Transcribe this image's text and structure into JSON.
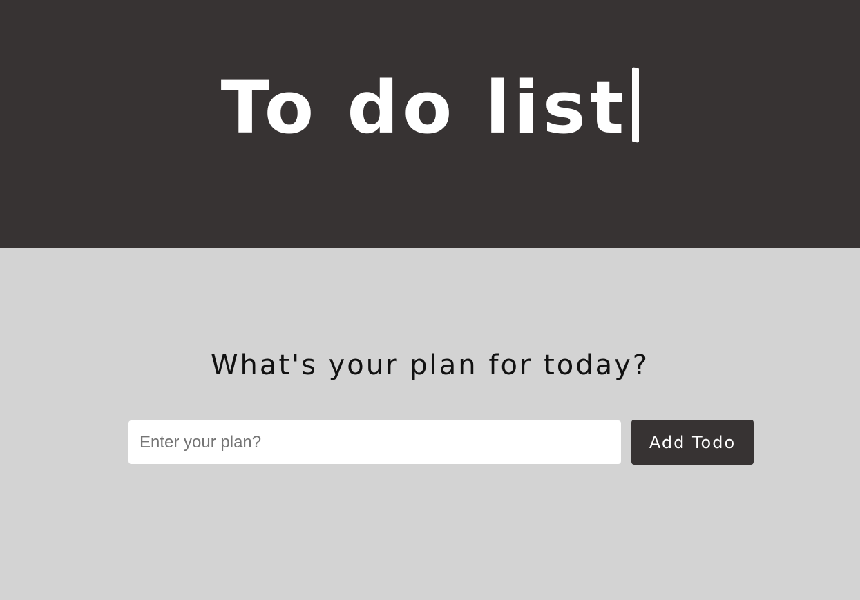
{
  "header": {
    "title": "To do list",
    "background_color": "#373333",
    "text_color": "#ffffff"
  },
  "main": {
    "subtitle": "What's your plan for today?",
    "background_color": "#d3d3d3"
  },
  "form": {
    "input_value": "",
    "input_placeholder": "Enter your plan?",
    "add_button_label": "Add Todo"
  }
}
